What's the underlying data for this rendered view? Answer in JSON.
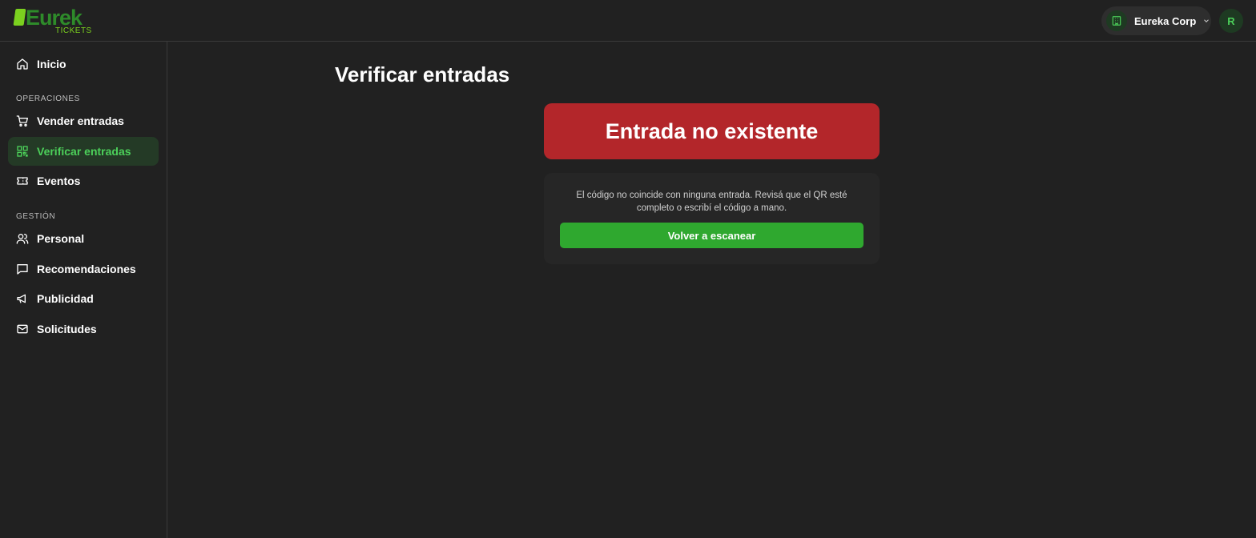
{
  "brand": {
    "logo_word": "Eurek",
    "logo_sub": "TICKETS",
    "accent_color": "#4cd05a",
    "logo_green": "#7bd11f"
  },
  "header": {
    "org_name": "Eureka Corp",
    "org_icon": "building-icon",
    "avatar_initial": "R"
  },
  "sidebar": {
    "home": {
      "label": "Inicio",
      "icon": "home-icon"
    },
    "section_operations": "OPERACIONES",
    "operations": [
      {
        "label": "Vender entradas",
        "icon": "cart-icon",
        "active": false
      },
      {
        "label": "Verificar entradas",
        "icon": "qr-code-icon",
        "active": true
      },
      {
        "label": "Eventos",
        "icon": "ticket-icon",
        "active": false
      }
    ],
    "section_management": "GESTIÓN",
    "management": [
      {
        "label": "Personal",
        "icon": "users-icon"
      },
      {
        "label": "Recomendaciones",
        "icon": "message-icon"
      },
      {
        "label": "Publicidad",
        "icon": "megaphone-icon"
      },
      {
        "label": "Solicitudes",
        "icon": "mail-icon"
      }
    ]
  },
  "main": {
    "title": "Verificar entradas",
    "status": {
      "text": "Entrada no existente",
      "color": "#b3262a"
    },
    "message": "El código no coincide con ninguna entrada. Revisá que el QR esté completo o escribí el código a mano.",
    "rescan_button": "Volver a escanear",
    "button_color": "#2fa82f"
  }
}
